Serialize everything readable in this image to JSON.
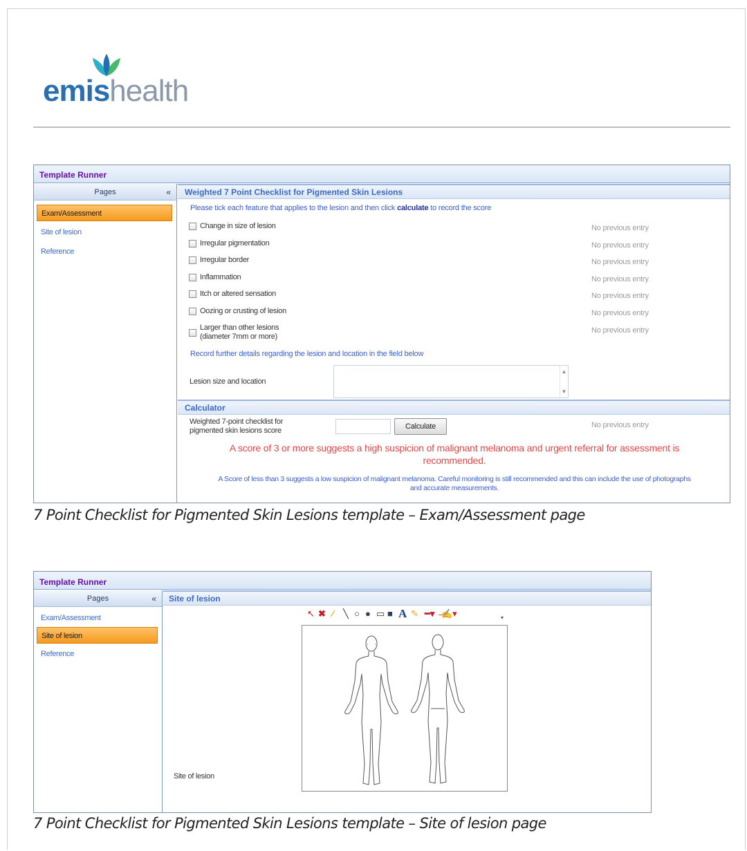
{
  "brand": {
    "bold": "emis",
    "light": "health",
    "leaf_colors": [
      "#2bb0c8",
      "#1f6fb2",
      "#4ab86b"
    ]
  },
  "window_title": "Template Runner",
  "pages_header": "Pages",
  "collapse_icon": "«",
  "nav_items": [
    "Exam/Assessment",
    "Site of lesion",
    "Reference"
  ],
  "exam": {
    "section_title": "Weighted 7 Point Checklist for Pigmented Skin Lesions",
    "instruction_pre": "Please tick each feature that applies to the lesion and then click",
    "instruction_bold": "calculate",
    "instruction_post": "to record the score",
    "checklist": [
      {
        "label": "Change in size of lesion",
        "status": "No previous entry",
        "checked": false
      },
      {
        "label": "Irregular pigmentation",
        "status": "No previous entry",
        "checked": false
      },
      {
        "label": "Irregular border",
        "status": "No previous entry",
        "checked": false
      },
      {
        "label": "Inflammation",
        "status": "No previous entry",
        "checked": false
      },
      {
        "label": "Itch or altered sensation",
        "status": "No previous entry",
        "checked": false
      },
      {
        "label": "Oozing or crusting of lesion",
        "status": "No previous entry",
        "checked": false
      },
      {
        "label_line1": "Larger than other lesions",
        "label_line2": "(diameter 7mm or more)",
        "status": "No previous entry",
        "checked": false
      }
    ],
    "details_prompt": "Record further details regarding the lesion and location in the field below",
    "lesion_field_label": "Lesion size and location",
    "lesion_field_value": "",
    "calculator_title": "Calculator",
    "score_label_line1": "Weighted 7-point checklist for",
    "score_label_line2": "pigmented skin lesions score",
    "score_value": "",
    "calculate_button": "Calculate",
    "score_status": "No previous entry",
    "warning_line1": "A score of 3 or more suggests a high suspicion of malignant melanoma and urgent referral for assessment is",
    "warning_line2": "recommended.",
    "note_line1": "A Score of less than 3 suggests a low suspicion of malignant melanoma. Careful monitoring is still recommended and this can include the use of photographs",
    "note_line2": "and accurate measurements."
  },
  "caption_exam": "7 Point Checklist for Pigmented Skin Lesions template – Exam/Assessment page",
  "site": {
    "section_title": "Site of lesion",
    "field_label": "Site of lesion",
    "toolbar_icons": [
      "pointer-icon",
      "delete-icon",
      "pencil-icon",
      "line-icon",
      "ellipse-icon",
      "filled-ellipse-icon",
      "rectangle-icon",
      "filled-rectangle-icon",
      "text-icon",
      "highlighter-icon",
      "line-color-icon",
      "fill-color-icon"
    ]
  },
  "caption_site": "7 Point Checklist for Pigmented Skin Lesions template – Site of lesion page",
  "colors": {
    "active_nav": "#f59a1e",
    "title_purple": "#6a0dad",
    "link_blue": "#3a6ac8",
    "warning_red": "#e84545"
  }
}
